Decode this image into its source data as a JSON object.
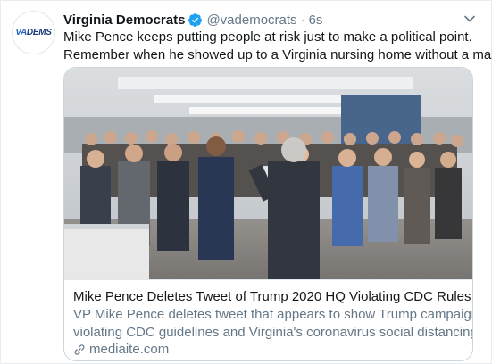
{
  "tweet": {
    "avatar_text_a": "VA",
    "avatar_text_b": "DEMS",
    "name": "Virginia Democrats",
    "handle": "@vademocrats",
    "separator": "·",
    "time": "6s",
    "text_lines": [
      "Mike Pence keeps putting people at risk just to make a political point.",
      "Remember when he showed up to a Virginia nursing home without a mask?"
    ]
  },
  "card": {
    "title": "Mike Pence Deletes Tweet of Trump 2020 HQ Violating CDC Rules",
    "description_lines": [
      "VP Mike Pence deletes tweet that appears to show Trump campaign HQ",
      "violating CDC guidelines and Virginia's coronavirus social distancing laws"
    ],
    "domain": "mediaite.com"
  },
  "colors": {
    "verified": "#1da1f2",
    "secondary_text": "#657786",
    "border": "#ccd6dd"
  },
  "icons": {
    "verified": "verified-badge-icon",
    "menu": "chevron-down-icon",
    "link": "link-icon"
  }
}
